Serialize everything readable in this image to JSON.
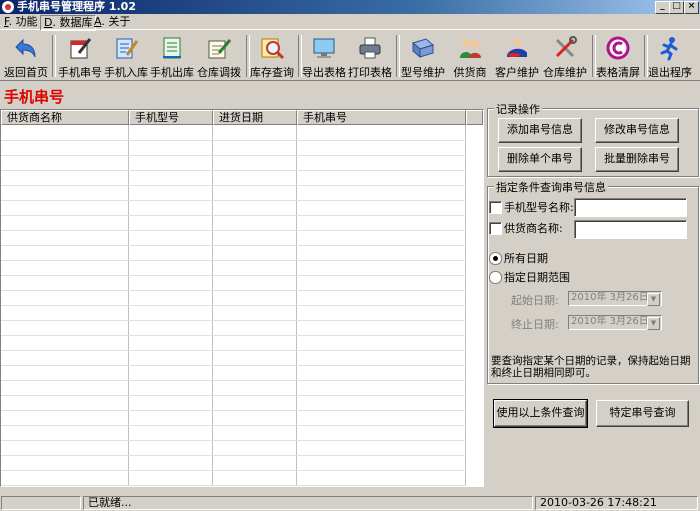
{
  "window": {
    "title": "手机串号管理程序 1.02"
  },
  "menu": [
    {
      "key": "F",
      "rest": ". 功能"
    },
    {
      "key": "D",
      "rest": ". 数据库"
    },
    {
      "key": "A",
      "rest": ". 关于"
    }
  ],
  "toolbar": {
    "back": "返回首页",
    "serial": "手机串号",
    "stock_in": "手机入库",
    "stock_out": "手机出库",
    "transfer": "仓库调拨",
    "inventory": "库存查询",
    "export": "导出表格",
    "print": "打印表格",
    "model": "型号维护",
    "supplier": "供货商",
    "customer": "客户维护",
    "warehouse": "仓库维护",
    "clear": "表格清屏",
    "exit": "退出程序"
  },
  "page_title": "手机串号",
  "table": {
    "columns": [
      "供货商名称",
      "手机型号",
      "进货日期",
      "手机串号"
    ],
    "rows": []
  },
  "records": {
    "title": "记录操作",
    "add": "添加串号信息",
    "edit": "修改串号信息",
    "delete_one": "删除单个串号",
    "delete_batch": "批量删除串号"
  },
  "query": {
    "title": "指定条件查询串号信息",
    "model_label": "手机型号名称:",
    "model_value": "",
    "supplier_label": "供货商名称:",
    "supplier_value": "",
    "all_dates": "所有日期",
    "date_range": "指定日期范围",
    "start_label": "起始日期:",
    "start_value": "2010年 3月26日",
    "end_label": "终止日期:",
    "end_value": "2010年 3月26日",
    "hint": "要查询指定某个日期的记录，保持起始日期和终止日期相同即可。",
    "model_checked": false,
    "supplier_checked": false,
    "selected_option": "all"
  },
  "actions": {
    "query_all": "使用以上条件查询",
    "query_serial": "特定串号查询"
  },
  "status": {
    "message": "已就绪...",
    "datetime": "2010-03-26 17:48:21"
  },
  "colors": {
    "title_text": "#e00000",
    "face": "#d4d0c8",
    "titlebar": "#0a246a"
  }
}
